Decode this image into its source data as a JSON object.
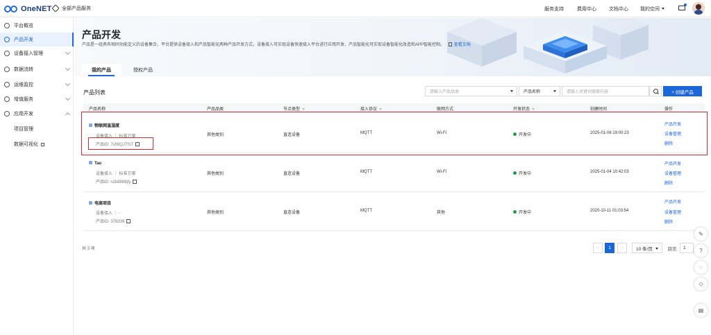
{
  "topbar": {
    "logo_text": "OneNET",
    "all_services": "全部产品服务",
    "nav": [
      "服务支持",
      "费用中心",
      "文档中心",
      "我的空间"
    ]
  },
  "sidebar": {
    "items": [
      {
        "label": "平台概览",
        "icon": "dashboard-icon"
      },
      {
        "label": "产品开发",
        "icon": "product-icon"
      },
      {
        "label": "设备接入管理",
        "icon": "device-icon"
      },
      {
        "label": "数据流转",
        "icon": "data-flow-icon"
      },
      {
        "label": "运维监控",
        "icon": "monitor-icon"
      },
      {
        "label": "增值服务",
        "icon": "value-added-icon"
      },
      {
        "label": "应用开发",
        "icon": "app-dev-icon"
      }
    ],
    "subitems": [
      "项目管理",
      "数据可视化"
    ]
  },
  "hero": {
    "title": "产品开发",
    "description": "产品是一组具有相同功能定义的设备集合，平台提供设备接入和产品智能化两种产品开发方式，设备接入可实现设备快速接入平台进行应用开发，产品智能化可实现设备智能化改造和APP智能控制。",
    "doc_link": "查看文档"
  },
  "tabs": [
    "我的产品",
    "授权产品"
  ],
  "list": {
    "title": "产品列表",
    "filter_placeholder": "请输入产品品类",
    "search_field": "产品名称",
    "search_placeholder": "请输入关键词搜索内容",
    "create_button": "+ 创建产品"
  },
  "table": {
    "headers": [
      "产品名称",
      "产品品类",
      "节点类型",
      "接入协议",
      "联网方式",
      "开发状态",
      "创建时间",
      "操作"
    ],
    "rows": [
      {
        "name": "物联网温湿度",
        "sub": "设备接入 ｜ 标准方案",
        "pid": "产品ID: 7v59QJTf1T",
        "category": "其他类别",
        "node": "直连设备",
        "protocol": "MQTT",
        "network": "Wi-Fi",
        "status": "开发中",
        "created": "2025-01-06 19:00:23"
      },
      {
        "name": "Tao",
        "sub": "设备接入 ｜ 标准方案",
        "pid": "产品ID: n2k8889jfy",
        "category": "其他类别",
        "node": "直连设备",
        "protocol": "MQTT",
        "network": "Wi-Fi",
        "status": "开发中",
        "created": "2025-01-04 10:42:03"
      },
      {
        "name": "电商项目",
        "sub": "设备接入 ｜ -",
        "pid": "产品ID: 378339",
        "category": "其他类别",
        "node": "直连设备",
        "protocol": "MQTT",
        "network": "其他",
        "status": "开发中",
        "created": "2020-10-11 01:03:54"
      }
    ],
    "ops": [
      "产品开发",
      "设备管理",
      "删除"
    ]
  },
  "pager": {
    "total": "共 3 项",
    "current": "1",
    "page_size": "10 条/页",
    "jump_label": "跳至",
    "jump_value": "1"
  },
  "colors": {
    "accent": "#1b66d8",
    "highlight": "#d6272f",
    "status": "#1d9d4b"
  }
}
